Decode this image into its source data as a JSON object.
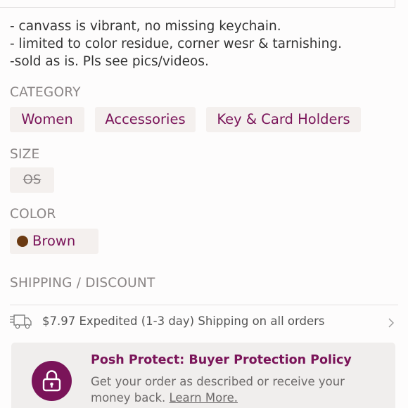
{
  "description": {
    "lines": [
      "- canvass is vibrant, no missing keychain.",
      "- limited to color residue, corner wesr & tarnishing.",
      "-sold as is. Pls see pics/videos."
    ]
  },
  "category": {
    "label": "CATEGORY",
    "chips": [
      "Women",
      "Accessories",
      "Key & Card Holders"
    ]
  },
  "size": {
    "label": "SIZE",
    "value": "OS"
  },
  "color": {
    "label": "COLOR",
    "value": "Brown",
    "swatch": "#6b3a12"
  },
  "shipping": {
    "label": "SHIPPING / DISCOUNT",
    "text": "$7.97 Expedited (1-3 day) Shipping on all orders",
    "icon": "truck-icon"
  },
  "posh_protect": {
    "title": "Posh Protect: Buyer Protection Policy",
    "body": "Get your order as described or receive your money back.",
    "link": "Learn More.",
    "icon": "lock-icon"
  },
  "colors": {
    "accent": "#7a1459",
    "chip_bg": "#f4f0ee",
    "label_gray": "#8a8585"
  }
}
